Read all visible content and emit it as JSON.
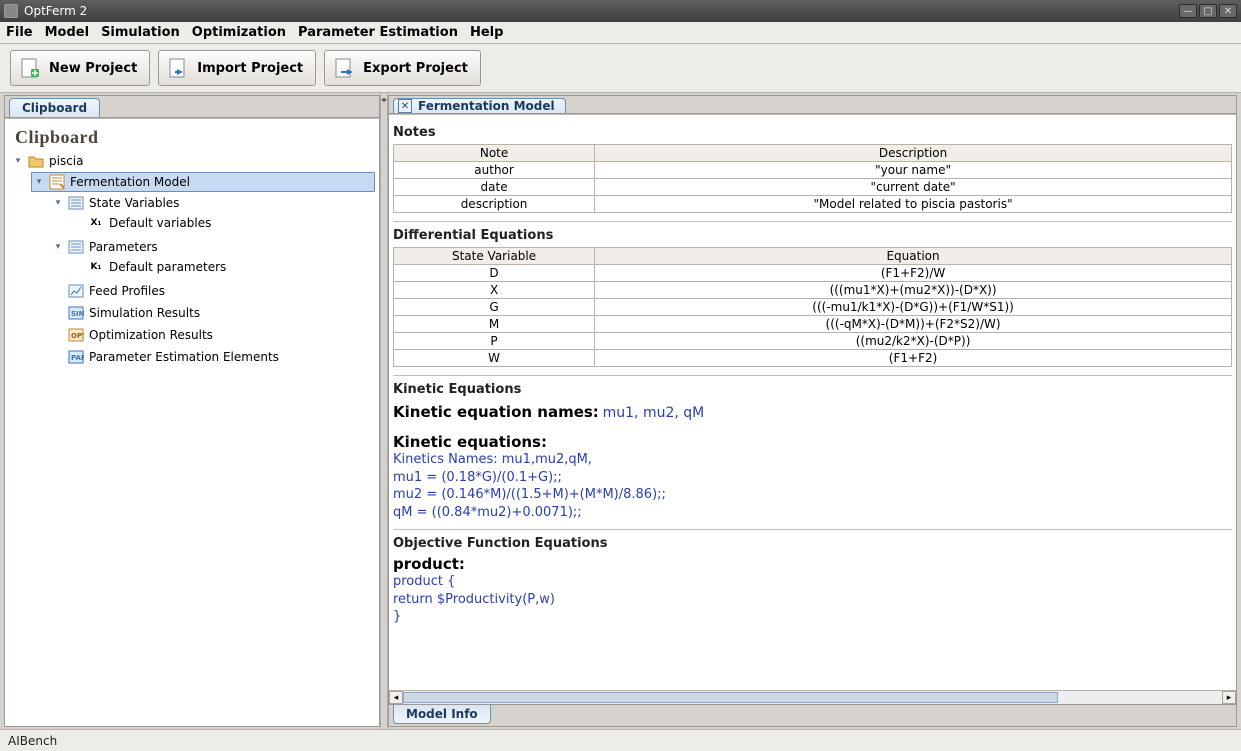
{
  "window": {
    "title": "OptFerm 2"
  },
  "menubar": [
    "File",
    "Model",
    "Simulation",
    "Optimization",
    "Parameter Estimation",
    "Help"
  ],
  "toolbar": {
    "new_project": "New Project",
    "import_project": "Import Project",
    "export_project": "Export Project"
  },
  "left": {
    "tab": "Clipboard",
    "heading": "Clipboard",
    "tree": {
      "project": "piscia",
      "model": "Fermentation Model",
      "state_variables": "State Variables",
      "default_variables": "Default variables",
      "parameters": "Parameters",
      "default_parameters": "Default parameters",
      "feed_profiles": "Feed Profiles",
      "simulation_results": "Simulation Results",
      "optimization_results": "Optimization Results",
      "param_est_elements": "Parameter Estimation Elements"
    }
  },
  "right": {
    "tab": "Fermentation Model",
    "bottom_tab": "Model Info",
    "notes": {
      "title": "Notes",
      "headers": {
        "note": "Note",
        "description": "Description"
      },
      "rows": [
        {
          "note": "author",
          "description": "\"your name\""
        },
        {
          "note": "date",
          "description": "\"current date\""
        },
        {
          "note": "description",
          "description": "\"Model related to piscia pastoris\""
        }
      ]
    },
    "diffeq": {
      "title": "Differential Equations",
      "headers": {
        "var": "State Variable",
        "eq": "Equation"
      },
      "rows": [
        {
          "var": "D",
          "eq": "(F1+F2)/W"
        },
        {
          "var": "X",
          "eq": "(((mu1*X)+(mu2*X))-(D*X))"
        },
        {
          "var": "G",
          "eq": "(((-mu1/k1*X)-(D*G))+(F1/W*S1))"
        },
        {
          "var": "M",
          "eq": "(((-qM*X)-(D*M))+(F2*S2)/W)"
        },
        {
          "var": "P",
          "eq": "((mu2/k2*X)-(D*P))"
        },
        {
          "var": "W",
          "eq": "(F1+F2)"
        }
      ]
    },
    "kinetic": {
      "title": "Kinetic Equations",
      "names_label": "Kinetic equation names:",
      "names_value": "mu1, mu2, qM",
      "eq_label": "Kinetic equations:",
      "lines": [
        "Kinetics Names: mu1,mu2,qM,",
        "mu1 = (0.18*G)/(0.1+G);;",
        "mu2 = (0.146*M)/((1.5+M)+(M*M)/8.86);;",
        "qM = ((0.84*mu2)+0.0071);;"
      ]
    },
    "objective": {
      "title": "Objective Function Equations",
      "label": "product:",
      "lines": [
        "product    {",
        "return $Productivity(P,w)",
        "}"
      ]
    }
  },
  "statusbar": "AIBench"
}
